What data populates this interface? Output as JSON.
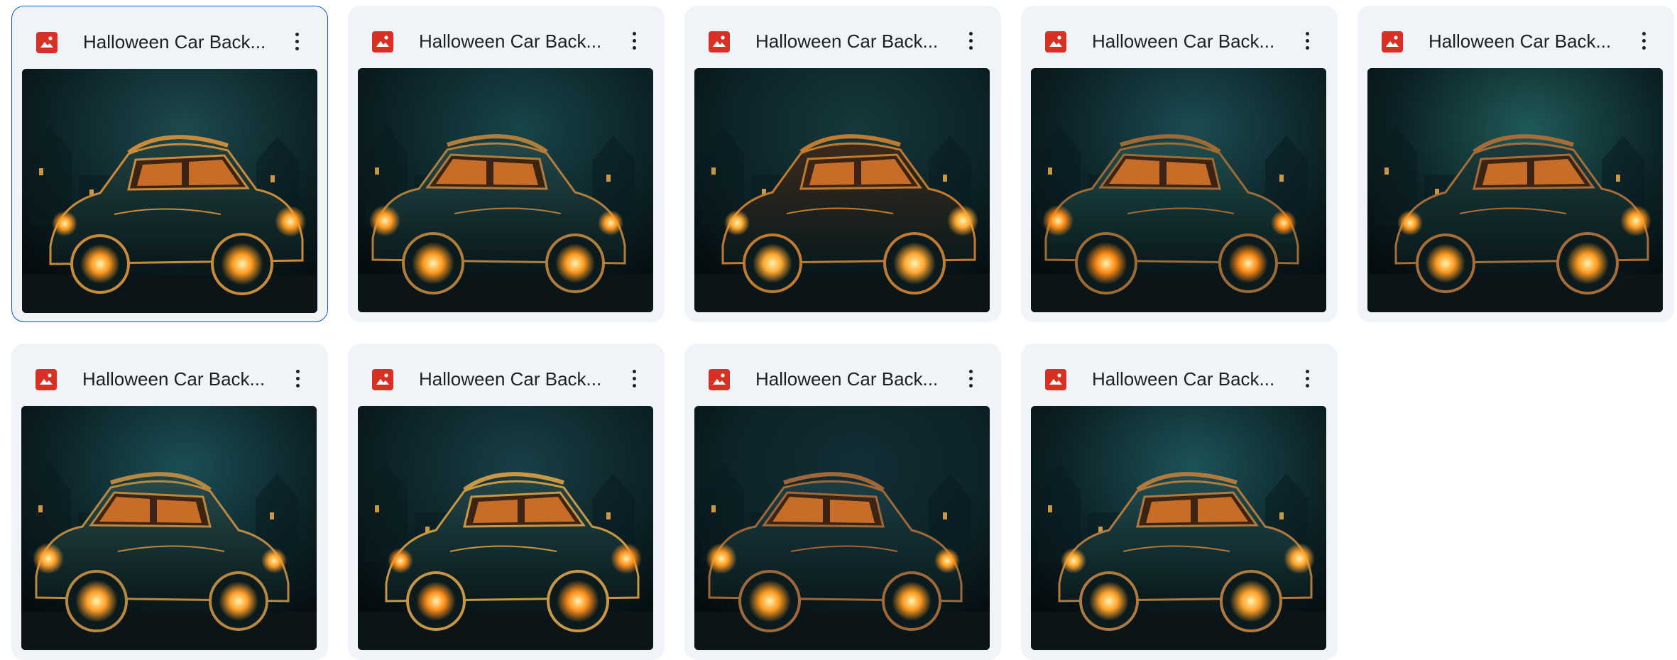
{
  "icons": {
    "file_type": "image-file-icon",
    "menu": "more-vert-icon"
  },
  "colors": {
    "file_icon": "#d93025",
    "card_bg": "#f0f4f9",
    "selected_border": "#0b57d0",
    "title_text": "#1f1f1f"
  },
  "files": [
    {
      "title": "Halloween Car Back...",
      "selected": true,
      "thumb": {
        "sky": "#1d4a4e",
        "body": "#20403f",
        "glow": "#ff9a1f",
        "trim": "#c98a3a"
      }
    },
    {
      "title": "Halloween Car Back...",
      "selected": false,
      "thumb": {
        "sky": "#174549",
        "body": "#23474a",
        "glow": "#ff9a1f",
        "trim": "#b07d3b"
      }
    },
    {
      "title": "Halloween Car Back...",
      "selected": false,
      "thumb": {
        "sky": "#15393c",
        "body": "#3a2a1c",
        "glow": "#ffa830",
        "trim": "#c27a2e"
      }
    },
    {
      "title": "Halloween Car Back...",
      "selected": false,
      "thumb": {
        "sky": "#1b4c52",
        "body": "#1f4c4d",
        "glow": "#ff8a14",
        "trim": "#9e6a33"
      }
    },
    {
      "title": "Halloween Car Back...",
      "selected": false,
      "thumb": {
        "sky": "#1f5a57",
        "body": "#1c3b3c",
        "glow": "#ff9a1f",
        "trim": "#a86c38"
      }
    },
    {
      "title": "Halloween Car Back...",
      "selected": false,
      "thumb": {
        "sky": "#1a4f55",
        "body": "#27494a",
        "glow": "#ff9e28",
        "trim": "#b98840"
      }
    },
    {
      "title": "Halloween Car Back...",
      "selected": false,
      "thumb": {
        "sky": "#183f46",
        "body": "#204447",
        "glow": "#ff8f1c",
        "trim": "#c99743"
      }
    },
    {
      "title": "Halloween Car Back...",
      "selected": false,
      "thumb": {
        "sky": "#122e35",
        "body": "#1b3d44",
        "glow": "#ff9a1f",
        "trim": "#a06838"
      }
    },
    {
      "title": "Halloween Car Back...",
      "selected": false,
      "thumb": {
        "sky": "#1c5358",
        "body": "#1f4a4d",
        "glow": "#ffa22a",
        "trim": "#b07a3e"
      }
    }
  ]
}
